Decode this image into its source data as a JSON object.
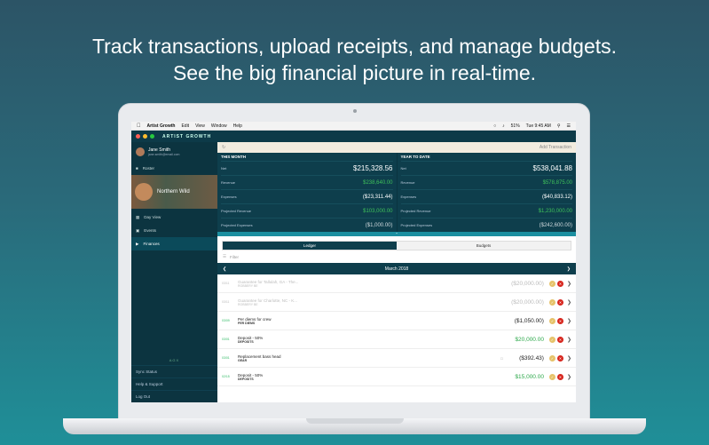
{
  "headline": {
    "line1": "Track transactions, upload receipts, and manage budgets.",
    "line2": "See the big financial picture in real-time."
  },
  "menubar": {
    "app": "Artist Growth",
    "items": [
      "Edit",
      "View",
      "Window",
      "Help"
    ],
    "battery": "51%",
    "clock": "Tue 9:45 AM"
  },
  "app": {
    "brand": "ARTIST GROWTH",
    "traffic_colors": [
      "#ff5f56",
      "#ffbd2e",
      "#27c93f"
    ]
  },
  "sidebar": {
    "user_name": "Jane Smith",
    "user_email": "jane.smith@email.com",
    "roster": "Roster",
    "artist": "Northern Wild",
    "items": [
      {
        "label": "Day View",
        "active": false
      },
      {
        "label": "Events",
        "active": false
      },
      {
        "label": "Finances",
        "active": true
      }
    ],
    "logo": "AGX",
    "bottom": [
      "Sync Status",
      "Help & Support",
      "Log Out"
    ]
  },
  "topstrip": {
    "add": "Add Transaction"
  },
  "summary": {
    "this_month": {
      "title": "THIS MONTH",
      "rows": [
        {
          "label": "Net",
          "value": "$215,328.56"
        },
        {
          "label": "Revenue",
          "value": "$238,640.00"
        },
        {
          "label": "Expenses",
          "value": "($23,311.44)"
        },
        {
          "label": "Projected Revenue",
          "value": "$103,000.00"
        },
        {
          "label": "Projected Expenses",
          "value": "($1,000.00)"
        }
      ]
    },
    "year_to_date": {
      "title": "YEAR TO DATE",
      "rows": [
        {
          "label": "Net",
          "value": "$538,041.88"
        },
        {
          "label": "Revenue",
          "value": "$578,875.00"
        },
        {
          "label": "Expenses",
          "value": "($40,833.12)"
        },
        {
          "label": "Projected Revenue",
          "value": "$1,230,000.00"
        },
        {
          "label": "Projected Expenses",
          "value": "($242,600.00)"
        }
      ]
    }
  },
  "tabs": {
    "ledger": "Ledger",
    "budgets": "Budgets"
  },
  "filter": "Filter",
  "month": "March 2018",
  "transactions": [
    {
      "date": "03/11",
      "title": "Guarantee for Tallulah, GA - The...",
      "sub": "ROBBERY BE",
      "amount": "($20,000.00)",
      "faded": true
    },
    {
      "date": "03/11",
      "title": "Guarantee for Charlotte, NC - K...",
      "sub": "ROBBERY BE",
      "amount": "($20,000.00)",
      "faded": true
    },
    {
      "date": "03/09",
      "title": "Per diems for crew",
      "sub": "PER DIEMS",
      "amount": "($1,050.00)",
      "faded": false
    },
    {
      "date": "03/01",
      "title": "Deposit - 50%",
      "sub": "DEPOSITS",
      "amount": "$20,000.00",
      "faded": false
    },
    {
      "date": "03/01",
      "title": "Replacement bass head",
      "sub": "GEAR",
      "amount": "($392.43)",
      "faded": false
    },
    {
      "date": "02/15",
      "title": "Deposit - 50%",
      "sub": "DEPOSITS",
      "amount": "$15,000.00",
      "faded": false
    }
  ]
}
